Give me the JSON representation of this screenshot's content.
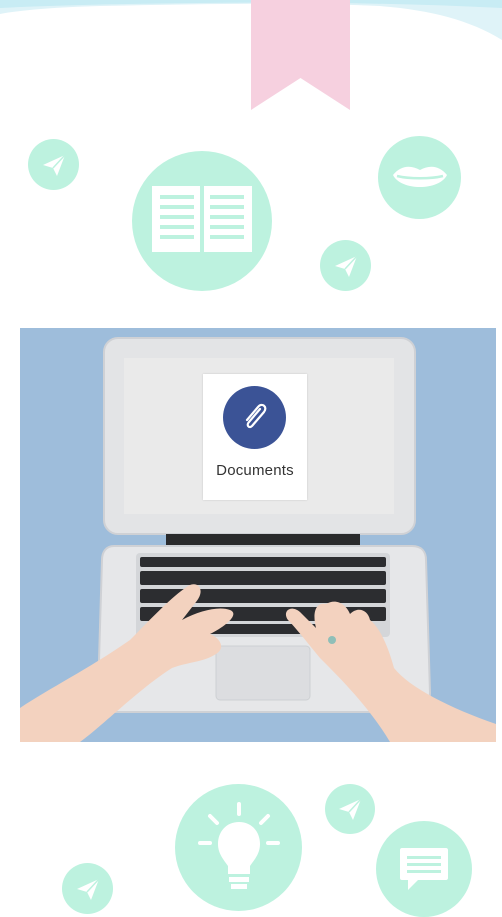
{
  "colors": {
    "mint": "#bdf2df",
    "bookmark": "#f6d0df",
    "wave": "#dff3f8",
    "photo_background": "#9ebddb",
    "clip_circle": "#3b5396"
  },
  "laptop_screen": {
    "card_title": "Documents",
    "card_subtitle": ""
  },
  "icons": [
    "bookmark-icon",
    "paper-plane-icon",
    "book-icon",
    "lips-icon",
    "paperclip-icon",
    "lightbulb-icon",
    "speech-bubble-icon"
  ]
}
